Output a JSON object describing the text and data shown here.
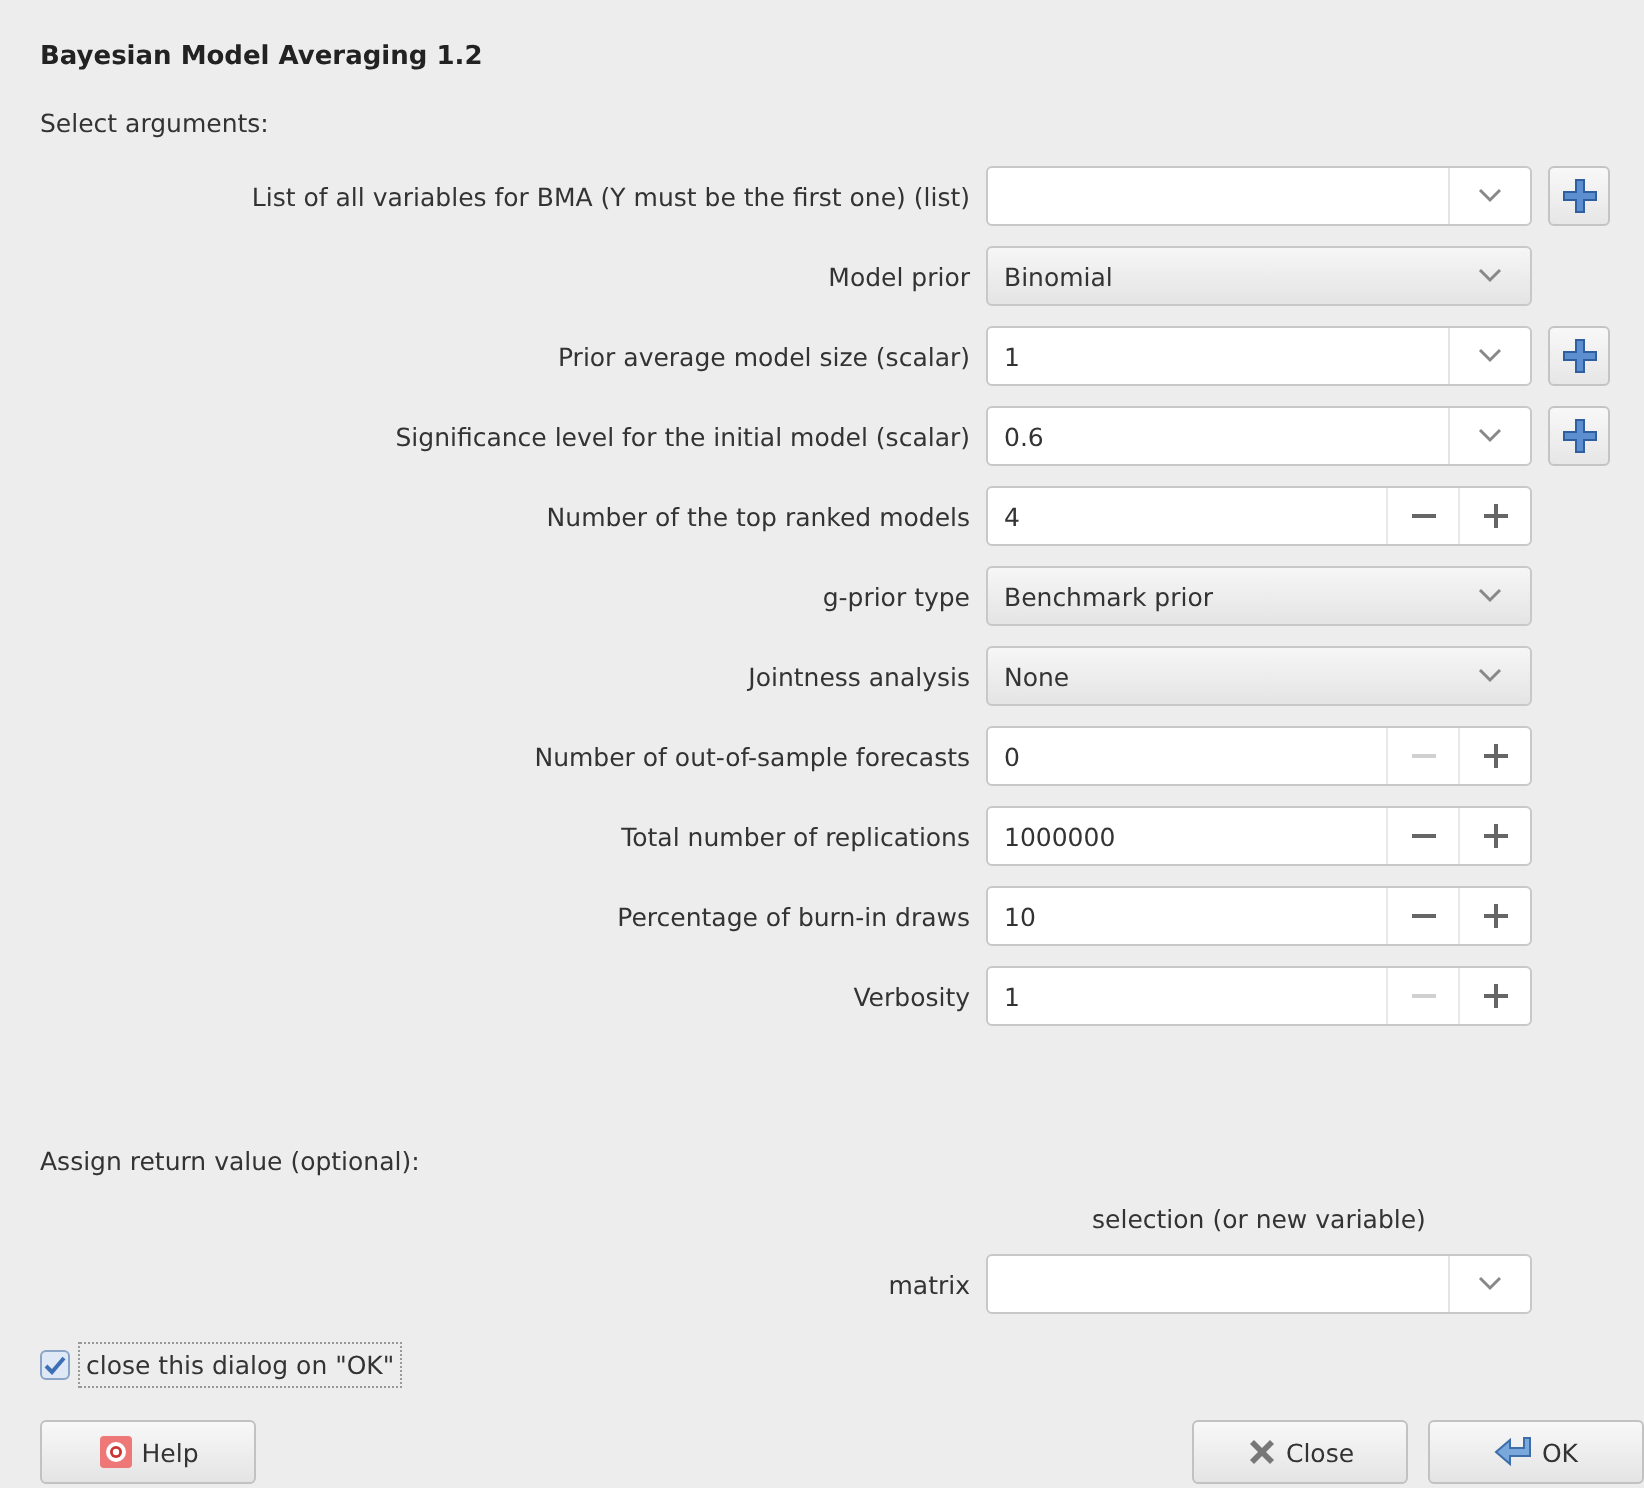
{
  "dialog": {
    "title": "Bayesian Model Averaging 1.2",
    "section_label": "Select arguments:"
  },
  "arguments": [
    {
      "label": "List of all variables for BMA (Y must be the first one) (list)",
      "kind": "editable",
      "add_button": true
    },
    {
      "label": "Model prior",
      "kind": "combo",
      "value": "Binomial",
      "add_button": false
    },
    {
      "label": "Prior average model size (scalar)",
      "kind": "editable",
      "value": "1",
      "add_button": true
    },
    {
      "label": "Significance level for the initial model (scalar)",
      "kind": "editable",
      "value": "0.6",
      "add_button": true
    },
    {
      "label": "Number of the top ranked models",
      "kind": "spin",
      "value": "4",
      "minus_disabled": false,
      "add_button": false
    },
    {
      "label": "g-prior type",
      "kind": "combo",
      "value": "Benchmark prior",
      "add_button": false
    },
    {
      "label": "Jointness analysis",
      "kind": "combo",
      "value": "None",
      "add_button": false
    },
    {
      "label": "Number of out-of-sample forecasts",
      "kind": "spin",
      "value": "0",
      "minus_disabled": true,
      "add_button": false
    },
    {
      "label": "Total number of replications",
      "kind": "spin",
      "value": "1000000",
      "minus_disabled": false,
      "add_button": false
    },
    {
      "label": "Percentage of burn-in draws",
      "kind": "spin",
      "value": "10",
      "minus_disabled": false,
      "add_button": false
    },
    {
      "label": "Verbosity",
      "kind": "spin",
      "value": "1",
      "minus_disabled": true,
      "add_button": false
    }
  ],
  "return_value": {
    "label": "Assign return value (optional):",
    "column_header": "selection (or new variable)",
    "field_label": "matrix"
  },
  "close_on_ok": {
    "label": "close this dialog on \"OK\"",
    "checked": true
  },
  "buttons": [
    {
      "label": "Help",
      "kind": "help"
    },
    {
      "label": "Close",
      "kind": "close"
    },
    {
      "label": "OK",
      "kind": "ok"
    }
  ]
}
